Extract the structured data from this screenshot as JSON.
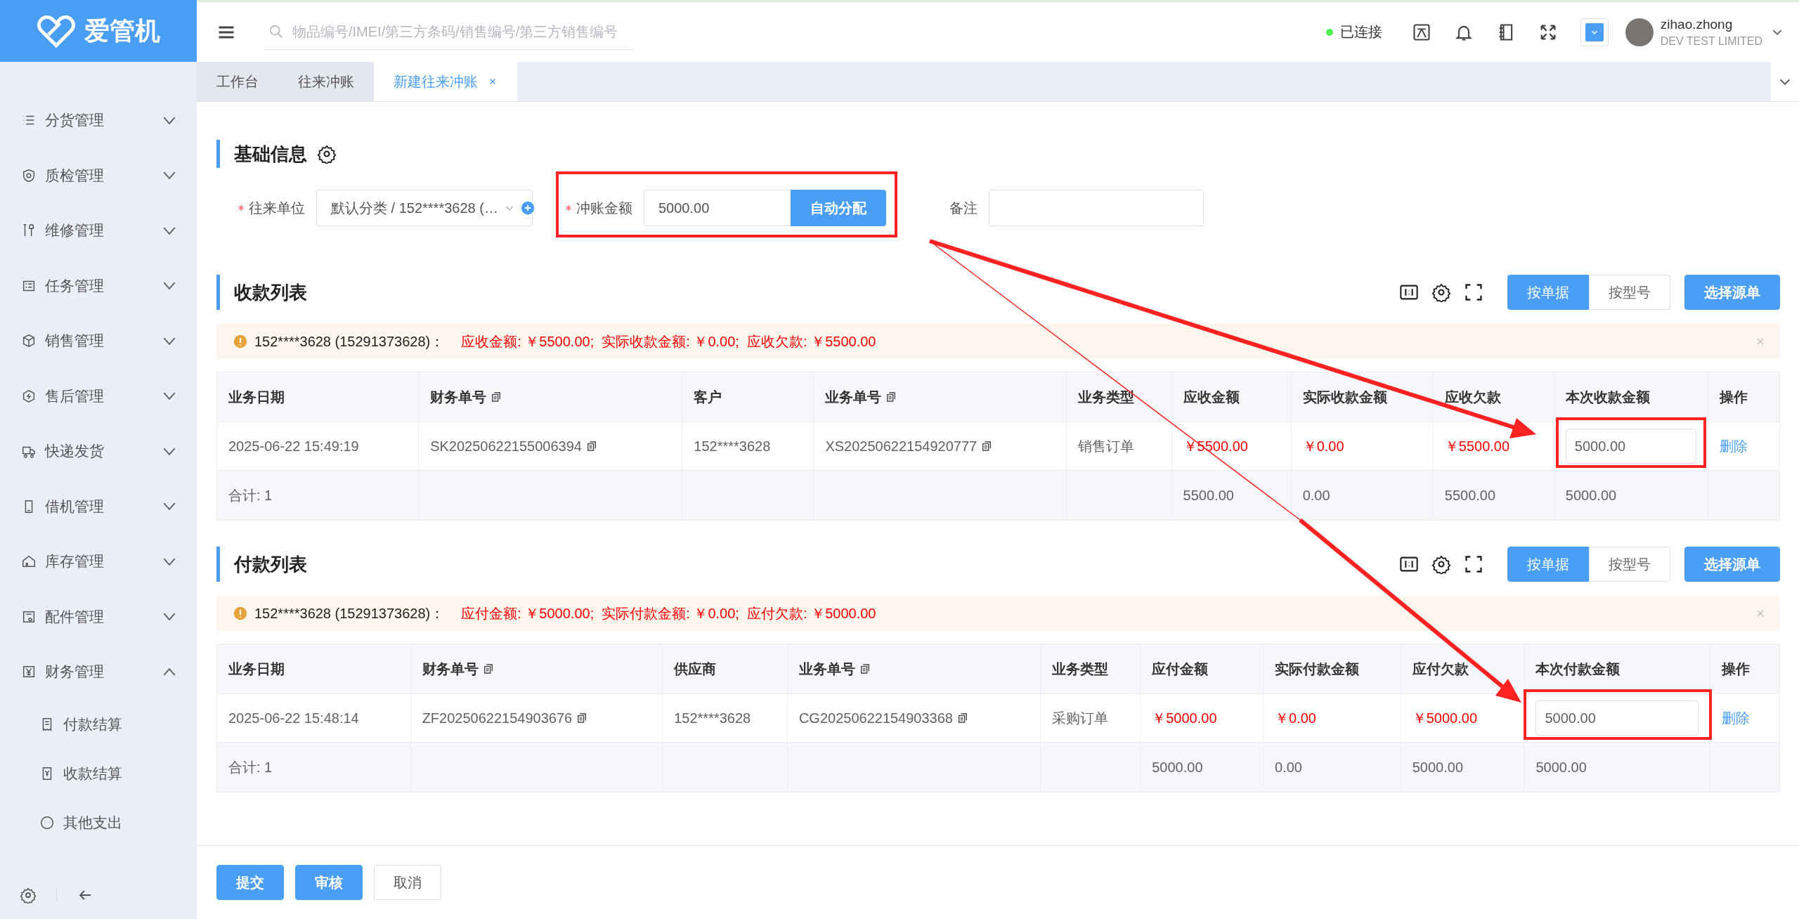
{
  "logo": {
    "text": "爱管机"
  },
  "topbar": {
    "search": {
      "placeholder": "物品编号/IMEI/第三方条码/销售编号/第三方销售编号"
    },
    "connection": {
      "label": "已连接",
      "connected": true
    },
    "user": {
      "name": "zihao.zhong",
      "company": "DEV TEST LIMITED"
    }
  },
  "sidebar": {
    "items": [
      {
        "label": "分货管理",
        "expanded": false
      },
      {
        "label": "质检管理",
        "expanded": false
      },
      {
        "label": "维修管理",
        "expanded": false
      },
      {
        "label": "任务管理",
        "expanded": false
      },
      {
        "label": "销售管理",
        "expanded": false
      },
      {
        "label": "售后管理",
        "expanded": false
      },
      {
        "label": "快递发货",
        "expanded": false
      },
      {
        "label": "借机管理",
        "expanded": false
      },
      {
        "label": "库存管理",
        "expanded": false
      },
      {
        "label": "配件管理",
        "expanded": false
      },
      {
        "label": "财务管理",
        "expanded": true,
        "children": [
          {
            "label": "付款结算"
          },
          {
            "label": "收款结算"
          },
          {
            "label": "其他支出"
          }
        ]
      }
    ]
  },
  "tabs": [
    {
      "label": "工作台",
      "selected": false
    },
    {
      "label": "往来冲账",
      "selected": false
    },
    {
      "label": "新建往来冲账",
      "selected": true
    }
  ],
  "basic_info": {
    "title": "基础信息",
    "fields": [
      {
        "kind": "select",
        "label": "往来单位",
        "required": true,
        "value": "默认分类 / 152****3628 (…"
      },
      {
        "kind": "amount",
        "label": "冲账金额",
        "required": true,
        "value": "5000.00",
        "button": "自动分配"
      },
      {
        "kind": "text",
        "label": "备注",
        "required": false
      }
    ]
  },
  "sections": [
    {
      "title": "收款列表",
      "view_toggle": [
        {
          "label": "按单据",
          "selected": true
        },
        {
          "label": "按型号",
          "selected": false
        }
      ],
      "select_button": "选择源单",
      "alert": {
        "party": "152****3628 (15291373628)：",
        "summary": "应收金额: ￥5500.00;  实际收款金额: ￥0.00;  应收欠款: ￥5500.00"
      },
      "table": {
        "columns": [
          {
            "label": "业务日期",
            "copy": false
          },
          {
            "label": "财务单号",
            "copy": true
          },
          {
            "label": "客户",
            "copy": false
          },
          {
            "label": "业务单号",
            "copy": true
          },
          {
            "label": "业务类型",
            "copy": false
          },
          {
            "label": "应收金额",
            "copy": false
          },
          {
            "label": "实际收款金额",
            "copy": false
          },
          {
            "label": "应收欠款",
            "copy": false
          },
          {
            "label": "本次收款金额",
            "copy": false
          },
          {
            "label": "操作",
            "copy": false
          }
        ],
        "rows": [
          {
            "cells": [
              {
                "kind": "text",
                "text": "2025-06-22 15:49:19"
              },
              {
                "kind": "copy",
                "text": "SK20250622155006394"
              },
              {
                "kind": "text",
                "text": "152****3628"
              },
              {
                "kind": "copy",
                "text": "XS20250622154920777"
              },
              {
                "kind": "text",
                "text": "销售订单"
              },
              {
                "kind": "amount",
                "text": "￥5500.00"
              },
              {
                "kind": "amount",
                "text": "￥0.00"
              },
              {
                "kind": "amount",
                "text": "￥5500.00"
              },
              {
                "kind": "input",
                "text": "5000.00"
              },
              {
                "kind": "link",
                "text": "删除"
              }
            ]
          }
        ],
        "summary": {
          "label": "合计: 1",
          "values": [
            "5500.00",
            "0.00",
            "5500.00",
            "5000.00"
          ]
        }
      }
    },
    {
      "title": "付款列表",
      "view_toggle": [
        {
          "label": "按单据",
          "selected": true
        },
        {
          "label": "按型号",
          "selected": false
        }
      ],
      "select_button": "选择源单",
      "alert": {
        "party": "152****3628 (15291373628)：",
        "summary": "应付金额: ￥5000.00;  实际付款金额: ￥0.00;  应付欠款: ￥5000.00"
      },
      "table": {
        "columns": [
          {
            "label": "业务日期",
            "copy": false
          },
          {
            "label": "财务单号",
            "copy": true
          },
          {
            "label": "供应商",
            "copy": false
          },
          {
            "label": "业务单号",
            "copy": true
          },
          {
            "label": "业务类型",
            "copy": false
          },
          {
            "label": "应付金额",
            "copy": false
          },
          {
            "label": "实际付款金额",
            "copy": false
          },
          {
            "label": "应付欠款",
            "copy": false
          },
          {
            "label": "本次付款金额",
            "copy": false
          },
          {
            "label": "操作",
            "copy": false
          }
        ],
        "rows": [
          {
            "cells": [
              {
                "kind": "text",
                "text": "2025-06-22 15:48:14"
              },
              {
                "kind": "copy",
                "text": "ZF20250622154903676"
              },
              {
                "kind": "text",
                "text": "152****3628"
              },
              {
                "kind": "copy",
                "text": "CG20250622154903368"
              },
              {
                "kind": "text",
                "text": "采购订单"
              },
              {
                "kind": "amount",
                "text": "￥5000.00"
              },
              {
                "kind": "amount",
                "text": "￥0.00"
              },
              {
                "kind": "amount",
                "text": "￥5000.00"
              },
              {
                "kind": "input",
                "text": "5000.00"
              },
              {
                "kind": "link",
                "text": "删除"
              }
            ]
          }
        ],
        "summary": {
          "label": "合计: 1",
          "values": [
            "5000.00",
            "0.00",
            "5000.00",
            "5000.00"
          ]
        }
      }
    }
  ],
  "footer": {
    "buttons": [
      {
        "label": "提交"
      },
      {
        "label": "审核"
      },
      {
        "label": "取消"
      }
    ]
  }
}
